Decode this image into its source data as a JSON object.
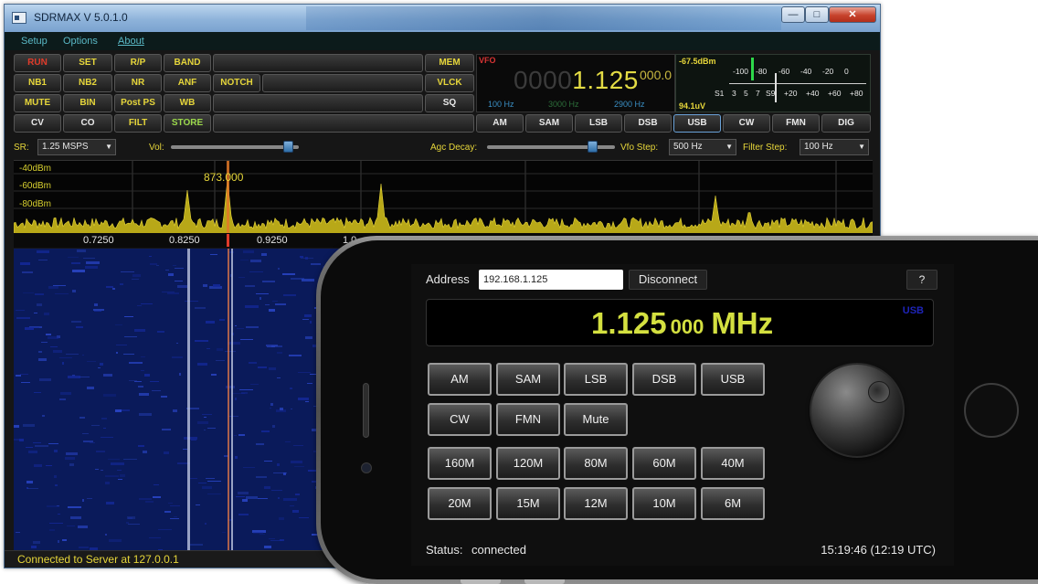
{
  "window": {
    "title": "SDRMAX V 5.0.1.0",
    "controls": {
      "minimize": "—",
      "maximize": "□",
      "close": "✕"
    }
  },
  "menu": [
    "Setup",
    "Options",
    "About"
  ],
  "buttons": {
    "row1": [
      "RUN",
      "SET",
      "R/P",
      "BAND",
      "",
      "MEM"
    ],
    "row2": [
      "NB1",
      "NB2",
      "NR",
      "ANF",
      "NOTCH",
      "",
      "VLCK"
    ],
    "row3": [
      "MUTE",
      "BIN",
      "Post PS",
      "WB",
      "",
      "SQ"
    ],
    "row4": [
      "CV",
      "CO",
      "FILT",
      "STORE",
      ""
    ],
    "modes": [
      "AM",
      "SAM",
      "LSB",
      "DSB",
      "USB",
      "CW",
      "FMN",
      "DIG"
    ],
    "active_mode": "USB"
  },
  "vfo": {
    "label": "VFO",
    "freq_dim": "0000",
    "freq_main": "1.125",
    "freq_sub": "000.0",
    "bw_low": "100 Hz",
    "bw_mid": "3000 Hz",
    "bw_high": "2900 Hz"
  },
  "smeter": {
    "dbm": "-67.5dBm",
    "uv": "94.1uV",
    "top_scale": [
      "-100",
      "-80",
      "-60",
      "-40",
      "-20",
      "0"
    ],
    "bottom_scale": [
      "S1",
      "3",
      "5",
      "7",
      "S9",
      "+20",
      "+40",
      "+60",
      "+80"
    ]
  },
  "controls": {
    "sr_label": "SR:",
    "sr_value": "1.25 MSPS",
    "vol_label": "Vol:",
    "vol_level": 0.95,
    "agc_label": "Agc Decay:",
    "agc_level": 0.85,
    "vfo_step_label": "Vfo Step:",
    "vfo_step_value": "500 Hz",
    "filter_step_label": "Filter Step:",
    "filter_step_value": "100 Hz"
  },
  "spectrum": {
    "levels": [
      "-40dBm",
      "-60dBm",
      "-80dBm"
    ],
    "marker": "873.000",
    "ticks": [
      "0.7250",
      "0.8250",
      "0.9250",
      "1.0"
    ]
  },
  "status": "Connected to Server at 127.0.0.1",
  "phone": {
    "address_label": "Address",
    "address_value": "192.168.1.125",
    "disconnect_label": "Disconnect",
    "help_label": "?",
    "freq_big": "1.125",
    "freq_small": "000",
    "freq_unit": "MHz",
    "freq_mode": "USB",
    "mode_buttons": [
      "AM",
      "SAM",
      "LSB",
      "DSB",
      "USB",
      "CW",
      "FMN",
      "Mute"
    ],
    "band_buttons": [
      "160M",
      "120M",
      "80M",
      "60M",
      "40M",
      "20M",
      "15M",
      "12M",
      "10M",
      "6M"
    ],
    "status_label": "Status:",
    "status_value": "connected",
    "time": "15:19:46 (12:19 UTC)"
  },
  "colors": {
    "accent_yellow": "#e6d63a",
    "vfo_digits": "#e3db44",
    "phone_freq": "#d4e040",
    "waterfall_bg": "#0a1a5a",
    "active_button_border": "#6aa2d8"
  }
}
